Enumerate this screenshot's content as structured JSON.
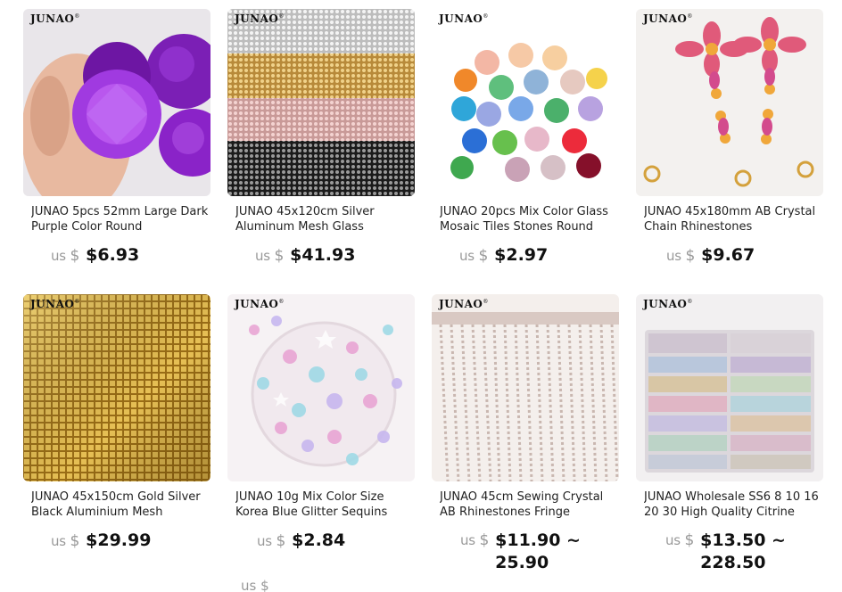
{
  "brand_mark": "JUNAO",
  "currency_prefix": "us",
  "currency_symbol": "$",
  "accent_colors": {
    "price_text": "#111111",
    "currency_text": "#999999"
  },
  "products": [
    {
      "title": "JUNAO 5pcs 52mm Large Dark Purple Color Round",
      "price": "$6.93",
      "image": "purple-faceted-rhinestones"
    },
    {
      "title": "JUNAO 45x120cm Silver Aluminum Mesh Glass",
      "price": "$41.93",
      "image": "rhinestone-mesh-rolls"
    },
    {
      "title": "JUNAO 20pcs Mix Color Glass Mosaic Tiles Stones Round",
      "price": "$2.97",
      "image": "glass-mosaic-cabochons"
    },
    {
      "title": "JUNAO 45x180mm AB Crystal Chain Rhinestones",
      "price": "$9.67",
      "image": "crystal-appliques"
    },
    {
      "title": "JUNAO 45x150cm Gold Silver Black Aluminium Mesh",
      "price": "$29.99",
      "image": "gold-metal-mesh"
    },
    {
      "title": "JUNAO 10g Mix Color Size Korea Blue Glitter Sequins",
      "price": "$2.84",
      "image": "glitter-sequins-dish"
    },
    {
      "title": "JUNAO 45cm Sewing Crystal AB Rhinestones Fringe",
      "price": "$11.90 ~",
      "price_line2": "25.90",
      "image": "rhinestone-fringe"
    },
    {
      "title": "JUNAO Wholesale SS6 8 10 16 20 30 High Quality Citrine",
      "price": "$13.50 ~",
      "price_line2": "228.50",
      "image": "bagged-rhinestones"
    }
  ],
  "next_row_currency": "us $"
}
